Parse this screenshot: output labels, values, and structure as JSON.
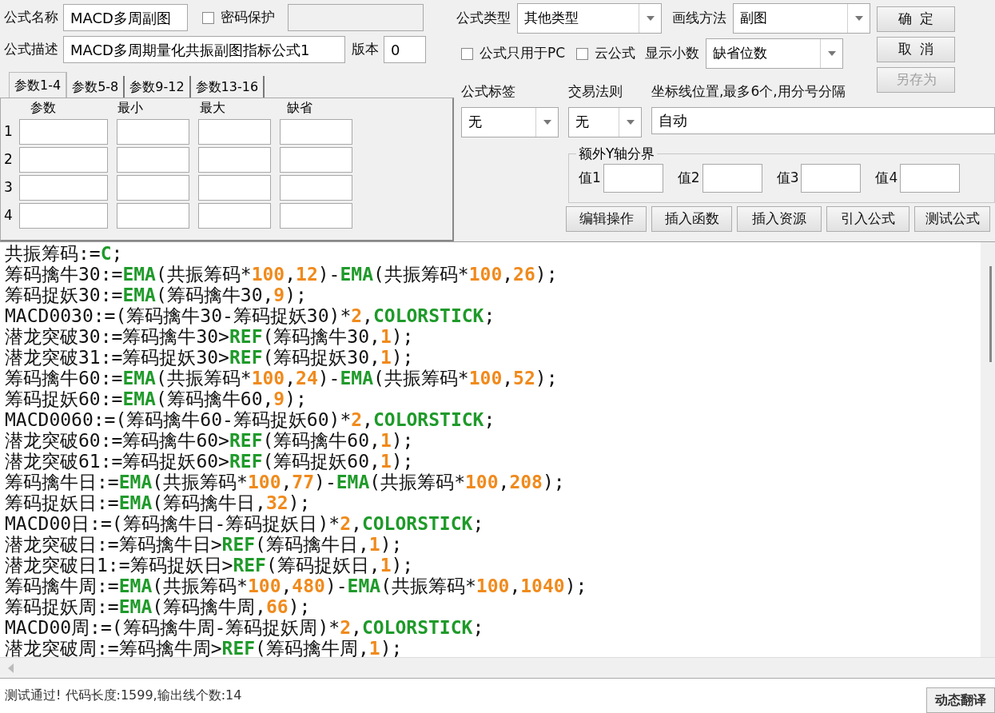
{
  "formula_name": {
    "label": "公式名称",
    "value": "MACD多周副图"
  },
  "password": {
    "label": "密码保护",
    "checked": false
  },
  "formula_desc": {
    "label": "公式描述",
    "value": "MACD多周期量化共振副图指标公式1"
  },
  "version": {
    "label": "版本",
    "value": "0"
  },
  "formula_type": {
    "label": "公式类型",
    "value": "其他类型"
  },
  "draw_method": {
    "label": "画线方法",
    "value": "副图"
  },
  "pc_only": {
    "label": "公式只用于PC",
    "checked": false
  },
  "cloud": {
    "label": "云公式",
    "checked": false
  },
  "decimals": {
    "label": "显示小数",
    "value": "缺省位数"
  },
  "side_buttons": [
    {
      "label": "确  定",
      "disabled": false
    },
    {
      "label": "取  消",
      "disabled": false
    },
    {
      "label": "另存为",
      "disabled": true
    }
  ],
  "param_tabs": [
    {
      "label": "参数1-4",
      "selected": true
    },
    {
      "label": "参数5-8",
      "selected": false
    },
    {
      "label": "参数9-12",
      "selected": false
    },
    {
      "label": "参数13-16",
      "selected": false
    }
  ],
  "param_columns": [
    "参数",
    "最小",
    "最大",
    "缺省"
  ],
  "param_rows": [
    "1",
    "2",
    "3",
    "4"
  ],
  "formula_tag": {
    "label": "公式标签",
    "value": "无"
  },
  "trade_rule": {
    "label": "交易法则",
    "value": "无"
  },
  "axis_lines": {
    "label": "坐标线位置,最多6个,用分号分隔",
    "value": "自动"
  },
  "y_bounds": {
    "title": "额外Y轴分界",
    "labels": [
      "值1",
      "值2",
      "值3",
      "值4"
    ]
  },
  "tool_buttons": [
    "编辑操作",
    "插入函数",
    "插入资源",
    "引入公式",
    "测试公式"
  ],
  "code_lines": [
    [
      {
        "kind": "plain",
        "text": "共振筹码:="
      },
      {
        "kind": "func",
        "text": "C"
      },
      {
        "kind": "plain",
        "text": ";"
      }
    ],
    [
      {
        "kind": "plain",
        "text": "筹码擒牛30:="
      },
      {
        "kind": "func",
        "text": "EMA"
      },
      {
        "kind": "plain",
        "text": "(共振筹码*"
      },
      {
        "kind": "num",
        "text": "100"
      },
      {
        "kind": "plain",
        "text": ","
      },
      {
        "kind": "num",
        "text": "12"
      },
      {
        "kind": "plain",
        "text": ")-"
      },
      {
        "kind": "func",
        "text": "EMA"
      },
      {
        "kind": "plain",
        "text": "(共振筹码*"
      },
      {
        "kind": "num",
        "text": "100"
      },
      {
        "kind": "plain",
        "text": ","
      },
      {
        "kind": "num",
        "text": "26"
      },
      {
        "kind": "plain",
        "text": ");"
      }
    ],
    [
      {
        "kind": "plain",
        "text": "筹码捉妖30:="
      },
      {
        "kind": "func",
        "text": "EMA"
      },
      {
        "kind": "plain",
        "text": "(筹码擒牛30,"
      },
      {
        "kind": "num",
        "text": "9"
      },
      {
        "kind": "plain",
        "text": ");"
      }
    ],
    [
      {
        "kind": "plain",
        "text": "MACD0030:=(筹码擒牛30-筹码捉妖30)*"
      },
      {
        "kind": "num",
        "text": "2"
      },
      {
        "kind": "plain",
        "text": ","
      },
      {
        "kind": "func",
        "text": "COLORSTICK"
      },
      {
        "kind": "plain",
        "text": ";"
      }
    ],
    [
      {
        "kind": "plain",
        "text": "潜龙突破30:=筹码擒牛30>"
      },
      {
        "kind": "func",
        "text": "REF"
      },
      {
        "kind": "plain",
        "text": "(筹码擒牛30,"
      },
      {
        "kind": "num",
        "text": "1"
      },
      {
        "kind": "plain",
        "text": ");"
      }
    ],
    [
      {
        "kind": "plain",
        "text": "潜龙突破31:=筹码捉妖30>"
      },
      {
        "kind": "func",
        "text": "REF"
      },
      {
        "kind": "plain",
        "text": "(筹码捉妖30,"
      },
      {
        "kind": "num",
        "text": "1"
      },
      {
        "kind": "plain",
        "text": ");"
      }
    ],
    [
      {
        "kind": "plain",
        "text": "筹码擒牛60:="
      },
      {
        "kind": "func",
        "text": "EMA"
      },
      {
        "kind": "plain",
        "text": "(共振筹码*"
      },
      {
        "kind": "num",
        "text": "100"
      },
      {
        "kind": "plain",
        "text": ","
      },
      {
        "kind": "num",
        "text": "24"
      },
      {
        "kind": "plain",
        "text": ")-"
      },
      {
        "kind": "func",
        "text": "EMA"
      },
      {
        "kind": "plain",
        "text": "(共振筹码*"
      },
      {
        "kind": "num",
        "text": "100"
      },
      {
        "kind": "plain",
        "text": ","
      },
      {
        "kind": "num",
        "text": "52"
      },
      {
        "kind": "plain",
        "text": ");"
      }
    ],
    [
      {
        "kind": "plain",
        "text": "筹码捉妖60:="
      },
      {
        "kind": "func",
        "text": "EMA"
      },
      {
        "kind": "plain",
        "text": "(筹码擒牛60,"
      },
      {
        "kind": "num",
        "text": "9"
      },
      {
        "kind": "plain",
        "text": ");"
      }
    ],
    [
      {
        "kind": "plain",
        "text": "MACD0060:=(筹码擒牛60-筹码捉妖60)*"
      },
      {
        "kind": "num",
        "text": "2"
      },
      {
        "kind": "plain",
        "text": ","
      },
      {
        "kind": "func",
        "text": "COLORSTICK"
      },
      {
        "kind": "plain",
        "text": ";"
      }
    ],
    [
      {
        "kind": "plain",
        "text": "潜龙突破60:=筹码擒牛60>"
      },
      {
        "kind": "func",
        "text": "REF"
      },
      {
        "kind": "plain",
        "text": "(筹码擒牛60,"
      },
      {
        "kind": "num",
        "text": "1"
      },
      {
        "kind": "plain",
        "text": ");"
      }
    ],
    [
      {
        "kind": "plain",
        "text": "潜龙突破61:=筹码捉妖60>"
      },
      {
        "kind": "func",
        "text": "REF"
      },
      {
        "kind": "plain",
        "text": "(筹码捉妖60,"
      },
      {
        "kind": "num",
        "text": "1"
      },
      {
        "kind": "plain",
        "text": ");"
      }
    ],
    [
      {
        "kind": "plain",
        "text": "筹码擒牛日:="
      },
      {
        "kind": "func",
        "text": "EMA"
      },
      {
        "kind": "plain",
        "text": "(共振筹码*"
      },
      {
        "kind": "num",
        "text": "100"
      },
      {
        "kind": "plain",
        "text": ","
      },
      {
        "kind": "num",
        "text": "77"
      },
      {
        "kind": "plain",
        "text": ")-"
      },
      {
        "kind": "func",
        "text": "EMA"
      },
      {
        "kind": "plain",
        "text": "(共振筹码*"
      },
      {
        "kind": "num",
        "text": "100"
      },
      {
        "kind": "plain",
        "text": ","
      },
      {
        "kind": "num",
        "text": "208"
      },
      {
        "kind": "plain",
        "text": ");"
      }
    ],
    [
      {
        "kind": "plain",
        "text": "筹码捉妖日:="
      },
      {
        "kind": "func",
        "text": "EMA"
      },
      {
        "kind": "plain",
        "text": "(筹码擒牛日,"
      },
      {
        "kind": "num",
        "text": "32"
      },
      {
        "kind": "plain",
        "text": ");"
      }
    ],
    [
      {
        "kind": "plain",
        "text": "MACD00日:=(筹码擒牛日-筹码捉妖日)*"
      },
      {
        "kind": "num",
        "text": "2"
      },
      {
        "kind": "plain",
        "text": ","
      },
      {
        "kind": "func",
        "text": "COLORSTICK"
      },
      {
        "kind": "plain",
        "text": ";"
      }
    ],
    [
      {
        "kind": "plain",
        "text": "潜龙突破日:=筹码擒牛日>"
      },
      {
        "kind": "func",
        "text": "REF"
      },
      {
        "kind": "plain",
        "text": "(筹码擒牛日,"
      },
      {
        "kind": "num",
        "text": "1"
      },
      {
        "kind": "plain",
        "text": ");"
      }
    ],
    [
      {
        "kind": "plain",
        "text": "潜龙突破日1:=筹码捉妖日>"
      },
      {
        "kind": "func",
        "text": "REF"
      },
      {
        "kind": "plain",
        "text": "(筹码捉妖日,"
      },
      {
        "kind": "num",
        "text": "1"
      },
      {
        "kind": "plain",
        "text": ");"
      }
    ],
    [
      {
        "kind": "plain",
        "text": "筹码擒牛周:="
      },
      {
        "kind": "func",
        "text": "EMA"
      },
      {
        "kind": "plain",
        "text": "(共振筹码*"
      },
      {
        "kind": "num",
        "text": "100"
      },
      {
        "kind": "plain",
        "text": ","
      },
      {
        "kind": "num",
        "text": "480"
      },
      {
        "kind": "plain",
        "text": ")-"
      },
      {
        "kind": "func",
        "text": "EMA"
      },
      {
        "kind": "plain",
        "text": "(共振筹码*"
      },
      {
        "kind": "num",
        "text": "100"
      },
      {
        "kind": "plain",
        "text": ","
      },
      {
        "kind": "num",
        "text": "1040"
      },
      {
        "kind": "plain",
        "text": ");"
      }
    ],
    [
      {
        "kind": "plain",
        "text": "筹码捉妖周:="
      },
      {
        "kind": "func",
        "text": "EMA"
      },
      {
        "kind": "plain",
        "text": "(筹码擒牛周,"
      },
      {
        "kind": "num",
        "text": "66"
      },
      {
        "kind": "plain",
        "text": ");"
      }
    ],
    [
      {
        "kind": "plain",
        "text": "MACD00周:=(筹码擒牛周-筹码捉妖周)*"
      },
      {
        "kind": "num",
        "text": "2"
      },
      {
        "kind": "plain",
        "text": ","
      },
      {
        "kind": "func",
        "text": "COLORSTICK"
      },
      {
        "kind": "plain",
        "text": ";"
      }
    ],
    [
      {
        "kind": "plain",
        "text": "潜龙突破周:=筹码擒牛周>"
      },
      {
        "kind": "func",
        "text": "REF"
      },
      {
        "kind": "plain",
        "text": "(筹码擒牛周,"
      },
      {
        "kind": "num",
        "text": "1"
      },
      {
        "kind": "plain",
        "text": ");"
      }
    ]
  ],
  "status": "测试通过! 代码长度:1599,输出线个数:14",
  "translate_button": "动态翻译"
}
